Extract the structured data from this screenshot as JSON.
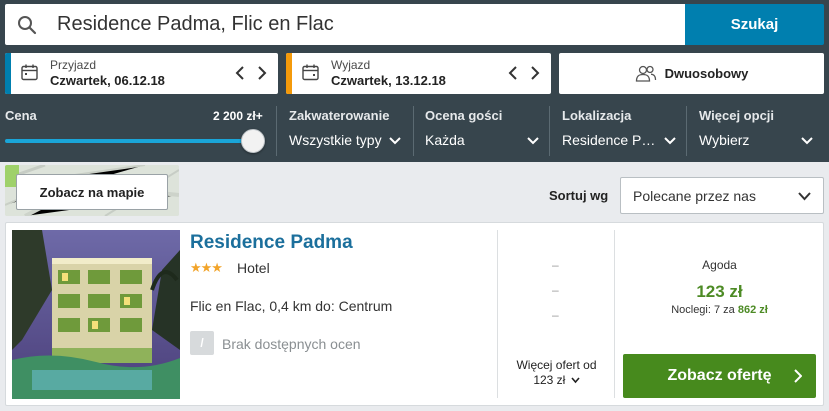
{
  "search": {
    "query": "Residence Padma, Flic en Flac",
    "button_label": "Szukaj"
  },
  "dates": {
    "checkin": {
      "label": "Przyjazd",
      "value": "Czwartek, 06.12.18",
      "accent": "#007faf"
    },
    "checkout": {
      "label": "Wyjazd",
      "value": "Czwartek, 13.12.18",
      "accent": "#f49a0b"
    }
  },
  "room": {
    "label": "Dwuosobowy"
  },
  "filters": {
    "price": {
      "label": "Cena",
      "max_value": "2 200 zł+",
      "level_percent": 100
    },
    "accommodation": {
      "label": "Zakwaterowanie",
      "value": "Wszystkie typy"
    },
    "rating": {
      "label": "Ocena gości",
      "value": "Każda"
    },
    "location": {
      "label": "Lokalizacja",
      "value": "Residence P…"
    },
    "more": {
      "label": "Więcej opcji",
      "value": "Wybierz"
    }
  },
  "map": {
    "button_label": "Zobacz na mapie"
  },
  "sort": {
    "label": "Sortuj wg",
    "value": "Polecane przez nas"
  },
  "result": {
    "name": "Residence Padma",
    "stars": "★★★",
    "star_count": 3,
    "type": "Hotel",
    "location": "Flic en Flac, 0,4 km do: Centrum",
    "rating_badge": "/",
    "rating_text": "Brak dostępnych ocen",
    "alt_offers": [
      "–",
      "–",
      "–"
    ],
    "more_offers_label": "Więcej ofert od",
    "more_offers_price": "123 zł",
    "provider": "Agoda",
    "price": "123 zł",
    "nights_prefix": "Noclegi: 7 za",
    "nights_total": "862 zł",
    "deal_button": "Zobacz ofertę"
  },
  "colors": {
    "header_bg": "#37454d",
    "search_button": "#007faf",
    "deal_button": "#478a1d",
    "price_green": "#4d8b25",
    "hotel_link": "#1b6f9c"
  }
}
